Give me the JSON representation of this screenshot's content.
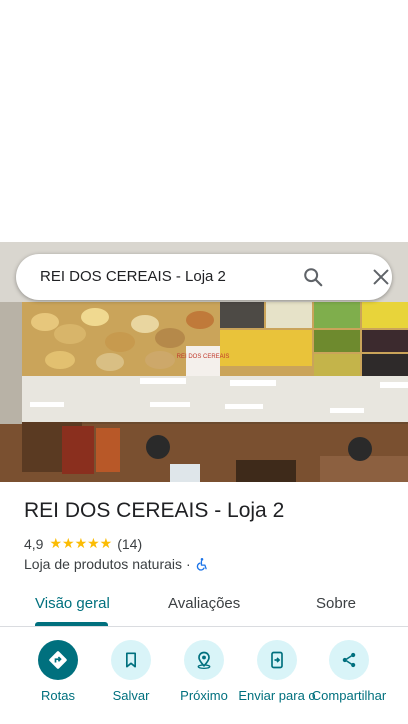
{
  "search": {
    "query": "REI DOS CEREAIS - Loja 2"
  },
  "place": {
    "name": "REI DOS CEREAIS - Loja 2",
    "rating": "4,9",
    "stars": "★★★★★",
    "reviews_count": "(14)",
    "category": "Loja de produtos naturais",
    "separator": "·",
    "sign_text": "REI DOS CEREAIS"
  },
  "tabs": [
    {
      "label": "Visão geral"
    },
    {
      "label": "Avaliações"
    },
    {
      "label": "Sobre"
    }
  ],
  "actions": [
    {
      "label": "Rotas",
      "icon": "directions-icon"
    },
    {
      "label": "Salvar",
      "icon": "bookmark-icon"
    },
    {
      "label": "Próximo",
      "icon": "nearby-icon"
    },
    {
      "label": "Enviar para o",
      "icon": "send-to-phone-icon"
    },
    {
      "label": "Compartilhar",
      "icon": "share-icon"
    }
  ],
  "colors": {
    "accent": "#00707e",
    "action_bg": "#d9f4f8",
    "star": "#fbbc04",
    "accessible": "#1a73e8"
  }
}
